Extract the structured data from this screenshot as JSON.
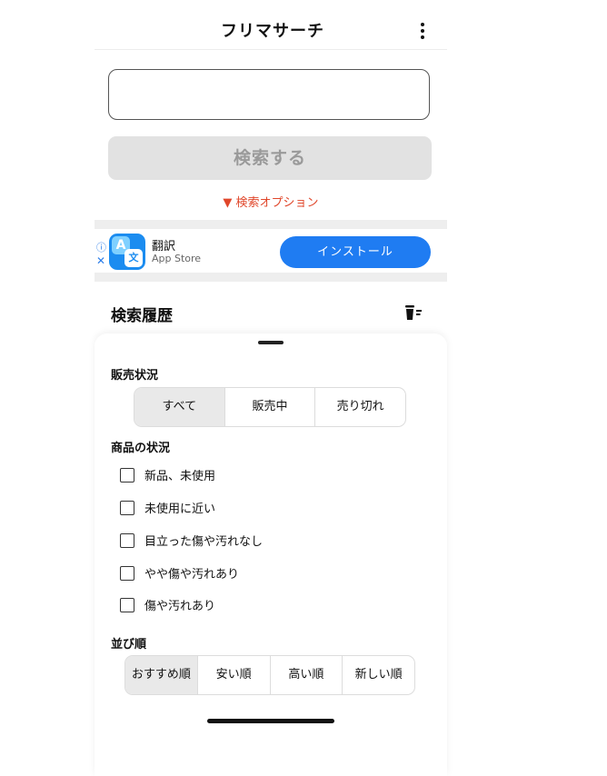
{
  "header": {
    "title": "フリマサーチ",
    "menu_icon": "more-vertical-icon"
  },
  "search": {
    "value": "",
    "placeholder": "",
    "button_label": "検索する",
    "options_link": "▼ 検索オプション"
  },
  "ad": {
    "info_icon": "ⓘ",
    "close_icon": "✕",
    "app_name": "翻訳",
    "store": "App Store",
    "install_label": "インストール",
    "icon_glyph_a": "A",
    "icon_glyph_b": "文"
  },
  "history": {
    "title": "検索履歴",
    "clear_icon": "trash-filter-icon"
  },
  "sheet": {
    "sales_status": {
      "label": "販売状況",
      "options": [
        "すべて",
        "販売中",
        "売り切れ"
      ],
      "selected": "すべて"
    },
    "condition": {
      "label": "商品の状況",
      "items": [
        {
          "label": "新品、未使用",
          "checked": false
        },
        {
          "label": "未使用に近い",
          "checked": false
        },
        {
          "label": "目立った傷や汚れなし",
          "checked": false
        },
        {
          "label": "やや傷や汚れあり",
          "checked": false
        },
        {
          "label": "傷や汚れあり",
          "checked": false
        }
      ]
    },
    "sort": {
      "label": "並び順",
      "options": [
        "おすすめ順",
        "安い順",
        "高い順",
        "新しい順"
      ],
      "selected": "おすすめ順"
    }
  },
  "colors": {
    "accent": "#1f7cf2",
    "options_link": "#e0462a",
    "disabled_button": "#e2e2e2"
  }
}
